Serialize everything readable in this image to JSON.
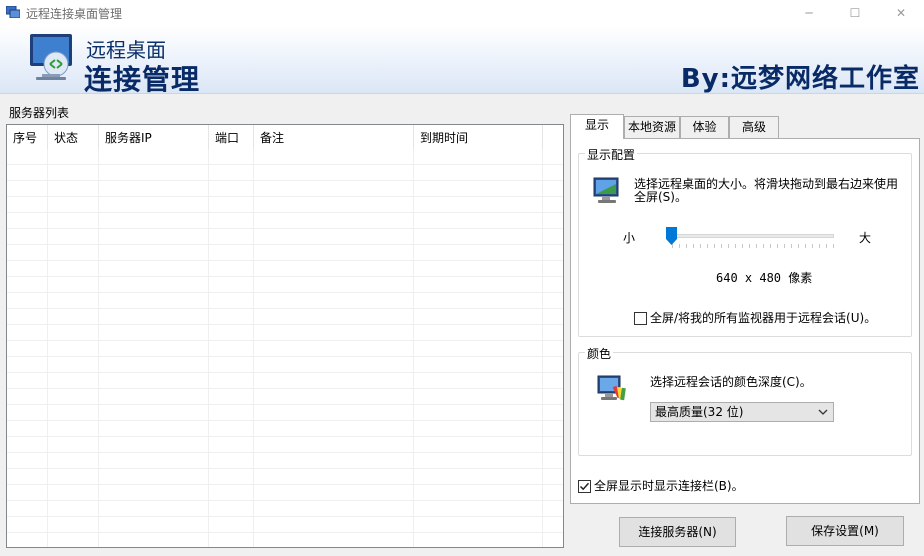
{
  "window": {
    "title": "远程连接桌面管理",
    "min_glyph": "─",
    "max_glyph": "☐",
    "close_glyph": "✕"
  },
  "banner": {
    "subtitle": "远程桌面",
    "title": "连接管理",
    "byline": "By:远梦网络工作室"
  },
  "server_list": {
    "label": "服务器列表",
    "columns": [
      "序号",
      "状态",
      "服务器IP",
      "端口",
      "备注",
      "到期时间"
    ],
    "rows": []
  },
  "tabs": [
    {
      "label": "显示",
      "active": true
    },
    {
      "label": "本地资源",
      "active": false
    },
    {
      "label": "体验",
      "active": false
    },
    {
      "label": "高级",
      "active": false
    }
  ],
  "display_config": {
    "group_title": "显示配置",
    "description": "选择远程桌面的大小。将滑块拖动到最右边来使用全屏(S)。",
    "slider_min_label": "小",
    "slider_max_label": "大",
    "slider_value_fraction": 0,
    "resolution_text": "640 x 480 像素",
    "all_monitors_label": "全屏/将我的所有监视器用于远程会话(U)。",
    "all_monitors_checked": false
  },
  "color_config": {
    "group_title": "颜色",
    "description": "选择远程会话的颜色深度(C)。",
    "selected_option": "最高质量(32 位)"
  },
  "show_connection_bar": {
    "label": "全屏显示时显示连接栏(B)。",
    "checked": true
  },
  "buttons": {
    "connect": "连接服务器(N)",
    "save": "保存设置(M)"
  },
  "colors": {
    "banner_text": "#082a66",
    "slider_thumb": "#0078d7"
  }
}
